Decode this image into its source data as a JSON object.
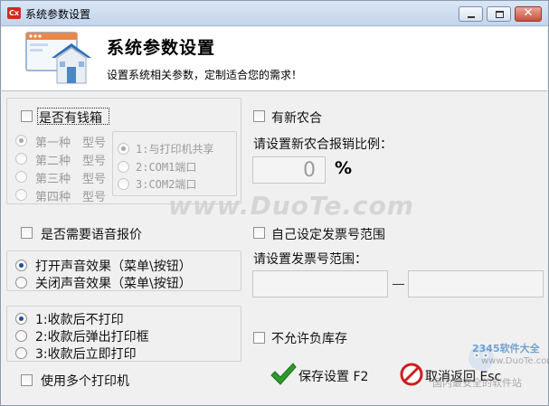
{
  "window": {
    "title": "系统参数设置",
    "app_icon_text": "Cx",
    "buttons": {
      "minimize": "minimize-icon",
      "maximize": "maximize-icon",
      "close": "close-icon",
      "close_glyph": "✕"
    }
  },
  "header": {
    "title": "系统参数设置",
    "subtitle": "设置系统相关参数，定制适合您的需求！",
    "icon": "house-settings-icon"
  },
  "cash_drawer": {
    "checkbox_label": "是否有钱箱",
    "checked": false,
    "types": [
      {
        "label": "第一种　型号",
        "selected": true
      },
      {
        "label": "第二种　型号",
        "selected": false
      },
      {
        "label": "第三种　型号",
        "selected": false
      },
      {
        "label": "第四种　型号",
        "selected": false
      }
    ],
    "ports": [
      {
        "label": "1:与打印机共享",
        "selected": true
      },
      {
        "label": "2:COM1端口",
        "selected": false
      },
      {
        "label": "3:COM2端口",
        "selected": false
      }
    ]
  },
  "nhc": {
    "checkbox_label": "有新农合",
    "checked": false,
    "ratio_label": "请设置新农合报销比例：",
    "ratio_value": "0",
    "percent_sign": "%"
  },
  "voice": {
    "checkbox_label": "是否需要语音报价",
    "checked": false,
    "sound_options": [
      {
        "label": "打开声音效果（菜单\\按钮）",
        "selected": true
      },
      {
        "label": "关闭声音效果（菜单\\按钮）",
        "selected": false
      }
    ]
  },
  "invoice": {
    "checkbox_label": "自己设定发票号范围",
    "checked": false,
    "range_label": "请设置发票号范围：",
    "range_from": "",
    "range_to": ""
  },
  "print": {
    "options": [
      {
        "label": "1:收款后不打印",
        "selected": true
      },
      {
        "label": "2:收款后弹出打印框",
        "selected": false
      },
      {
        "label": "3:收款后立即打印",
        "selected": false
      }
    ],
    "multi_printer_label": "使用多个打印机",
    "multi_printer_checked": false
  },
  "stock": {
    "checkbox_label": "不允许负库存",
    "checked": false
  },
  "actions": {
    "save_label": "保存设置 F2",
    "save_icon": "checkmark-icon",
    "cancel_label": "取消返回 Esc",
    "cancel_icon": "no-entry-icon"
  },
  "watermarks": {
    "site": "www.DuoTe.com",
    "brand": "2345软件大全",
    "brand_url": "www.DuoTe.com",
    "brand_tagline": "国内最安全的软件站"
  },
  "colors": {
    "accent_blue": "#1f4f9a",
    "save_green": "#2e9a2e",
    "cancel_red": "#cc1f1f"
  }
}
